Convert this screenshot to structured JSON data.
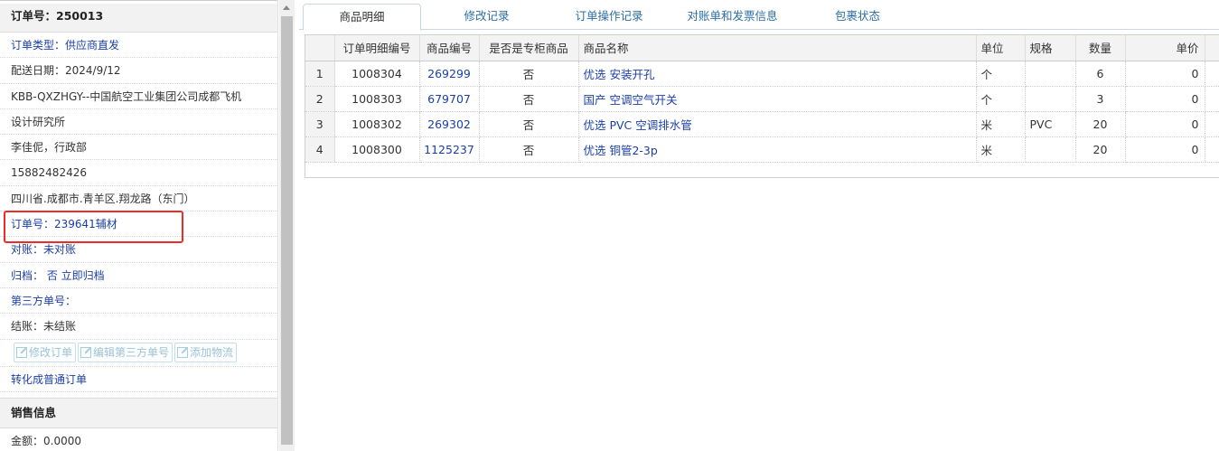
{
  "left": {
    "order_title": "订单号：250013",
    "rows": [
      {
        "text": "订单类型：供应商直发",
        "style": "link"
      },
      {
        "text": "配送日期：2024/9/12",
        "style": "plain"
      },
      {
        "text": "KBB-QXZHGY--中国航空工业集团公司成都飞机",
        "style": "plain"
      },
      {
        "text": "设计研究所",
        "style": "plain"
      },
      {
        "text": "李佳伲，行政部",
        "style": "plain"
      },
      {
        "text": "15882482426",
        "style": "plain"
      },
      {
        "text": "四川省.成都市.青羊区.翔龙路（东门）",
        "style": "plain"
      },
      {
        "text": "订单号：239641辅材",
        "style": "link"
      },
      {
        "text": "对账：未对账",
        "style": "link"
      },
      {
        "text": "归档： 否 立即归档",
        "style": "link"
      },
      {
        "text": "第三方单号：",
        "style": "link"
      },
      {
        "text": "结账：未结账",
        "style": "plain"
      }
    ],
    "buttons": [
      "修改订单",
      "编辑第三方单号",
      "添加物流"
    ],
    "convert_link": "转化成普通订单",
    "sales_section": "销售信息",
    "amount": "金额：0.0000"
  },
  "tabs": [
    "商品明细",
    "修改记录",
    "订单操作记录",
    "对账单和发票信息",
    "包裹状态"
  ],
  "active_tab": 0,
  "grid": {
    "headers": [
      "",
      "订单明细编号",
      "商品编号",
      "是否是专柜商品",
      "商品名称",
      "单位",
      "规格",
      "数量",
      "单价"
    ],
    "rows": [
      [
        "1",
        "1008304",
        "269299",
        "否",
        "优选 安装开孔",
        "个",
        "",
        "6",
        "0"
      ],
      [
        "2",
        "1008303",
        "679707",
        "否",
        "国产 空调空气开关",
        "个",
        "",
        "3",
        "0"
      ],
      [
        "3",
        "1008302",
        "269302",
        "否",
        "优选 PVC 空调排水管",
        "米",
        "PVC",
        "20",
        "0"
      ],
      [
        "4",
        "1008300",
        "1125237",
        "否",
        "优选 铜管2-3p",
        "米",
        "",
        "20",
        "0"
      ]
    ]
  },
  "icons": {
    "button_icon": "edit-icon",
    "scroll_up": "arrow-up-icon",
    "scroll_left": "arrow-left-icon"
  }
}
